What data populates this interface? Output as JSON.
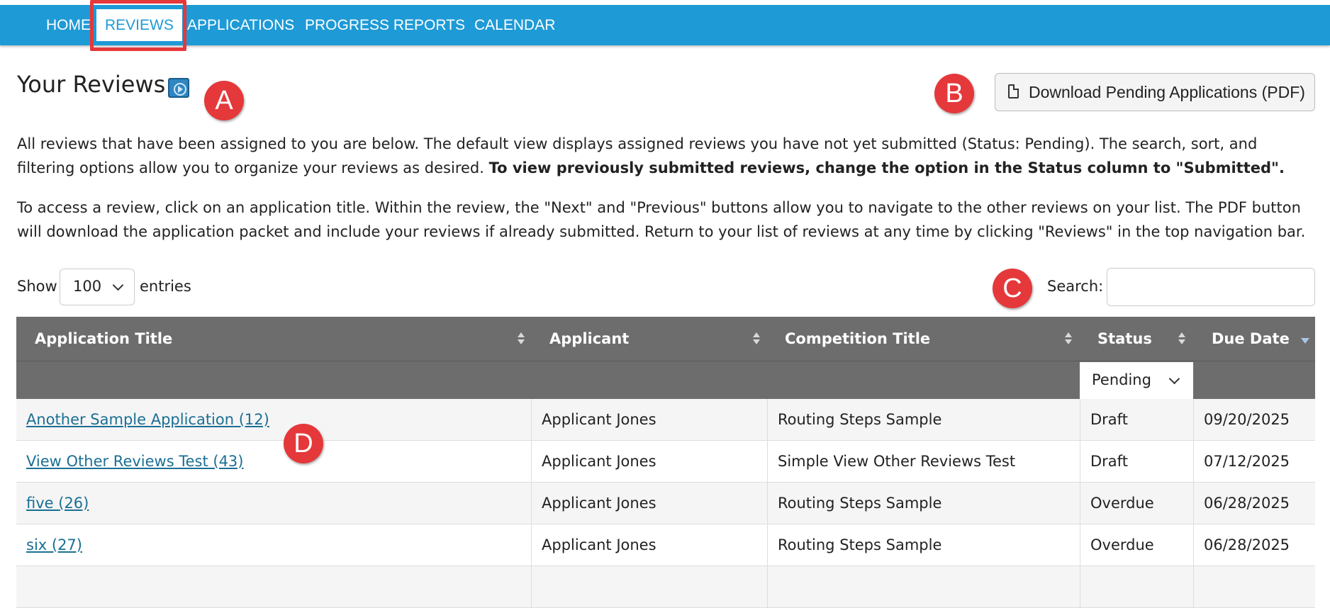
{
  "nav": {
    "items": [
      {
        "label": "HOME"
      },
      {
        "label": "REVIEWS",
        "active": true
      },
      {
        "label": "APPLICATIONS"
      },
      {
        "label": "PROGRESS REPORTS"
      },
      {
        "label": "CALENDAR"
      }
    ]
  },
  "header": {
    "title": "Your Reviews",
    "video_icon": "play-video-icon",
    "download_button": {
      "label": "Download Pending Applications (PDF)",
      "icon": "document-icon"
    }
  },
  "intro": {
    "paragraph1_text": "All reviews that have been assigned to you are below. The default view displays assigned reviews you have not yet submitted (Status: Pending). The search, sort, and filtering options allow you to organize your reviews as desired. ",
    "paragraph1_bold": "To view previously submitted reviews, change the option in the Status column to \"Submitted\".",
    "paragraph2": "To access a review, click on an application title. Within the review, the \"Next\" and \"Previous\" buttons allow you to navigate to the other reviews on your list. The PDF button will download the application packet and include your reviews if already submitted. Return to your list of reviews at any time by clicking \"Reviews\" in the top navigation bar."
  },
  "controls": {
    "show_label": "Show",
    "page_size": "100",
    "entries_label": "entries",
    "search_label": "Search:",
    "search_value": ""
  },
  "table": {
    "columns": [
      "Application Title",
      "Applicant",
      "Competition Title",
      "Status",
      "Due Date"
    ],
    "status_filter": "Pending",
    "rows": [
      {
        "title": "Another Sample Application (12)",
        "applicant": "Applicant Jones",
        "competition": "Routing Steps Sample",
        "status": "Draft",
        "due": "09/20/2025"
      },
      {
        "title": "View Other Reviews Test (43)",
        "applicant": "Applicant Jones",
        "competition": "Simple View Other Reviews Test",
        "status": "Draft",
        "due": "07/12/2025"
      },
      {
        "title": "five (26)",
        "applicant": "Applicant Jones",
        "competition": "Routing Steps Sample",
        "status": "Overdue",
        "due": "06/28/2025"
      },
      {
        "title": "six (27)",
        "applicant": "Applicant Jones",
        "competition": "Routing Steps Sample",
        "status": "Overdue",
        "due": "06/28/2025"
      },
      {
        "title": "",
        "applicant": "",
        "competition": "",
        "status": "",
        "due": ""
      }
    ]
  },
  "annotations": {
    "a": "A",
    "b": "B",
    "c": "C",
    "d": "D"
  },
  "colors": {
    "nav_bar": "#1e9ad6",
    "table_header": "#6d6d6d",
    "marker": "#e5383b",
    "link": "#1a6f94"
  }
}
